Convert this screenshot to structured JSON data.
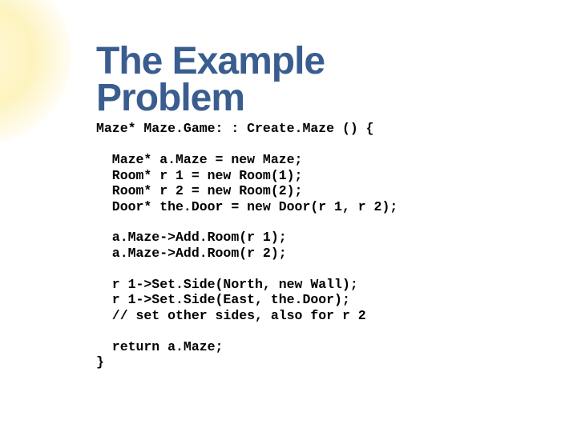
{
  "title_line1": "The Example",
  "title_line2": "Problem",
  "code": {
    "l1": "Maze* Maze.Game: : Create.Maze () {",
    "l2": "  Maze* a.Maze = new Maze;",
    "l3": "  Room* r 1 = new Room(1);",
    "l4": "  Room* r 2 = new Room(2);",
    "l5": "  Door* the.Door = new Door(r 1, r 2);",
    "l6": "  a.Maze->Add.Room(r 1);",
    "l7": "  a.Maze->Add.Room(r 2);",
    "l8": "  r 1->Set.Side(North, new Wall);",
    "l9": "  r 1->Set.Side(East, the.Door);",
    "l10": "  // set other sides, also for r 2",
    "l11": "  return a.Maze;",
    "l12": "}"
  }
}
